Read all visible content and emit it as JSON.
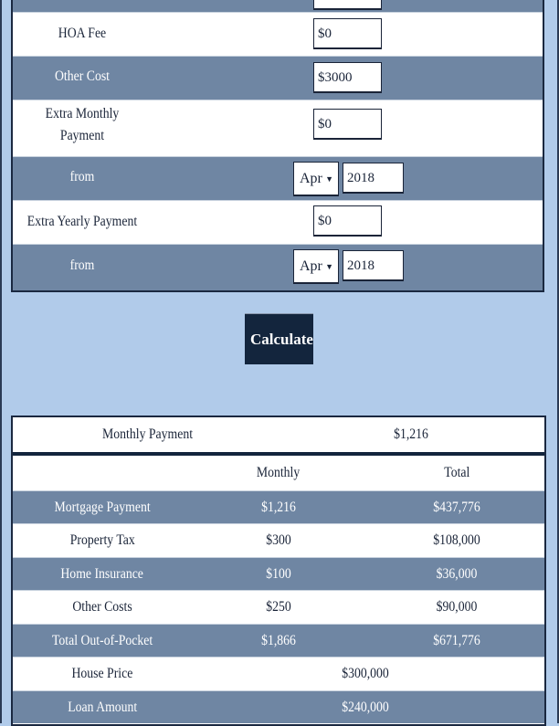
{
  "form": {
    "rows": [
      {
        "label": "HOA Fee",
        "value": "$0"
      },
      {
        "label": "Other Cost",
        "value": "$3000"
      },
      {
        "label": "Extra Monthly Payment",
        "label_line1": "Extra Monthly",
        "label_line2": "Payment",
        "value": "$0"
      },
      {
        "label": "from",
        "month": "Apr",
        "year": "2018"
      },
      {
        "label": "Extra Yearly Payment",
        "value": "$0"
      },
      {
        "label": "from",
        "month": "Apr",
        "year": "2018"
      }
    ]
  },
  "calculate_label": "Calculate",
  "results": {
    "monthly_payment_label": "Monthly Payment",
    "monthly_payment_value": "$1,216",
    "headers": [
      "",
      "Monthly",
      "Total"
    ],
    "rows": [
      {
        "label": "Mortgage Payment",
        "monthly": "$1,216",
        "total": "$437,776"
      },
      {
        "label": "Property Tax",
        "monthly": "$300",
        "total": "$108,000"
      },
      {
        "label": "Home Insurance",
        "monthly": "$100",
        "total": "$36,000"
      },
      {
        "label": "Other Costs",
        "monthly": "$250",
        "total": "$90,000"
      },
      {
        "label": "Total Out-of-Pocket",
        "monthly": "$1,866",
        "total": "$671,776"
      }
    ],
    "house_price_label": "House Price",
    "house_price_value": "$300,000",
    "loan_amount_label": "Loan Amount",
    "loan_amount_value": "$240,000"
  },
  "colors": {
    "background": "#b1cbea",
    "row_dark": "#6f86a3",
    "button": "#13253d"
  }
}
